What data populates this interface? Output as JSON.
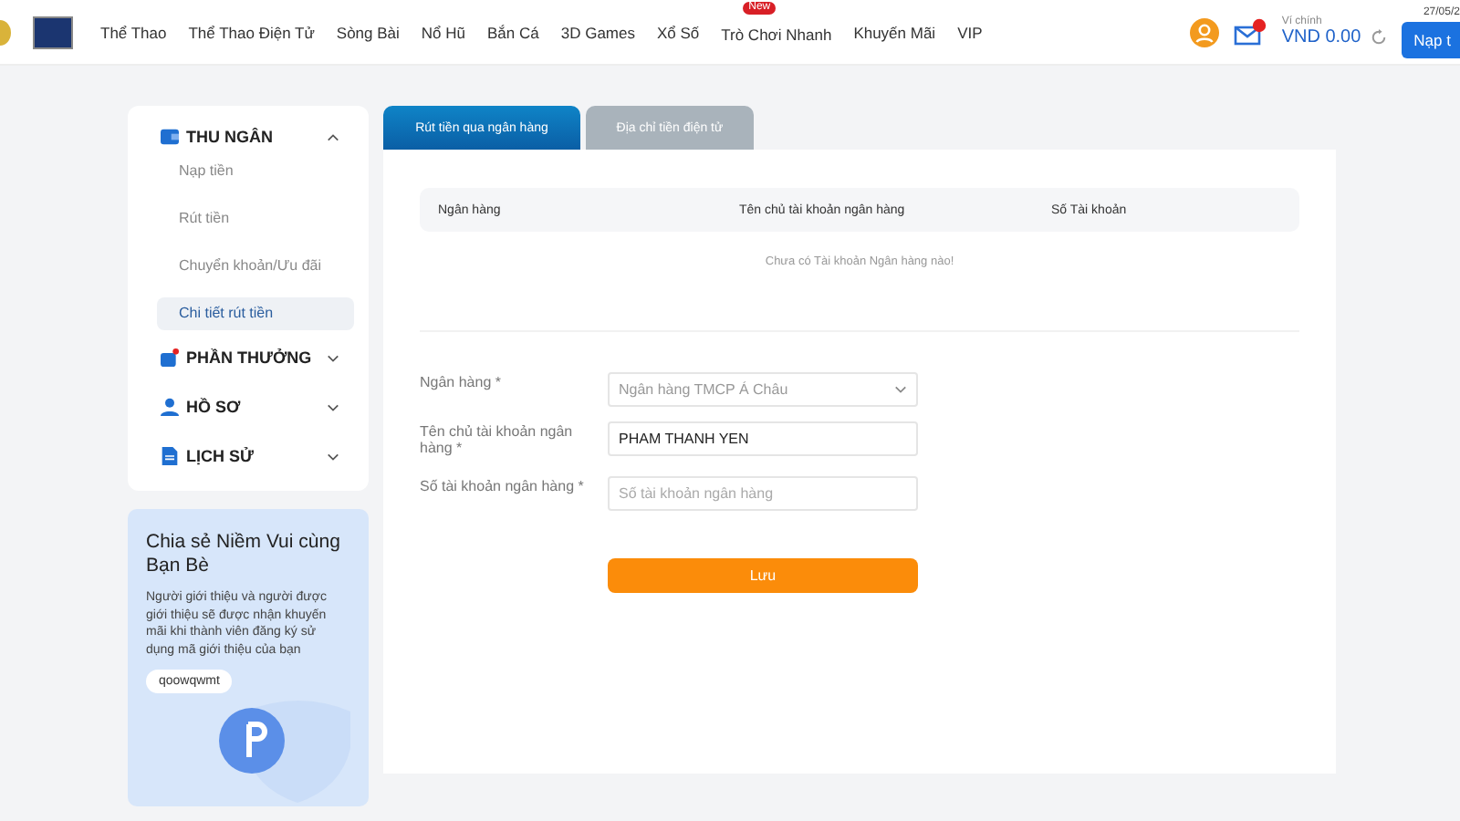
{
  "header": {
    "nav": [
      {
        "label": "Thể Thao"
      },
      {
        "label": "Thể Thao Điện Tử"
      },
      {
        "label": "Sòng Bài"
      },
      {
        "label": "Nổ Hũ"
      },
      {
        "label": "Bắn Cá"
      },
      {
        "label": "3D Games"
      },
      {
        "label": "Xổ Số"
      },
      {
        "label": "Trò Chơi Nhanh",
        "badge": "New"
      },
      {
        "label": "Khuyến Mãi"
      },
      {
        "label": "VIP"
      }
    ],
    "date": "27/05/2",
    "wallet_label": "Ví chính",
    "balance": "VND 0.00",
    "deposit_button": "Nạp t"
  },
  "sidebar": {
    "sections": [
      {
        "kind": "cashier",
        "label": "THU NGÂN",
        "expanded": true,
        "children": [
          {
            "label": "Nạp tiền",
            "selected": false
          },
          {
            "label": "Rút tiền",
            "selected": false
          },
          {
            "label": "Chuyển khoản/Ưu đãi",
            "selected": false
          },
          {
            "label": "Chi tiết rút tiền",
            "selected": true
          }
        ]
      },
      {
        "kind": "rewards",
        "label": "PHẦN THƯỞNG",
        "expanded": false
      },
      {
        "kind": "profile",
        "label": "HỒ SƠ",
        "expanded": false
      },
      {
        "kind": "history",
        "label": "LỊCH SỬ",
        "expanded": false
      }
    ],
    "referral": {
      "title": "Chia sẻ Niềm Vui cùng Bạn Bè",
      "text": "Người giới thiệu và người được giới thiệu sẽ được nhận khuyến mãi khi thành viên đăng ký sử dụng mã giới thiệu của bạn",
      "code": "qoowqwmt"
    }
  },
  "tabs": [
    {
      "label": "Rút tiền qua ngân hàng",
      "selected": true
    },
    {
      "label": "Địa chỉ tiền điện tử",
      "selected": false
    }
  ],
  "table": {
    "columns": [
      "Ngân hàng",
      "Tên chủ tài khoản ngân hàng",
      "Số Tài khoản"
    ],
    "empty_message": "Chưa có Tài khoản Ngân hàng nào!"
  },
  "form": {
    "fields": [
      {
        "kind": "select",
        "label": "Ngân hàng *",
        "value": "Ngân hàng TMCP Á Châu"
      },
      {
        "kind": "text",
        "label": "Tên chủ tài khoản ngân hàng *",
        "value": "PHAM THANH YEN"
      },
      {
        "kind": "text",
        "label": "Số tài khoản ngân hàng *",
        "placeholder": "Số tài khoản ngân hàng"
      }
    ],
    "save_button": "Lưu"
  }
}
